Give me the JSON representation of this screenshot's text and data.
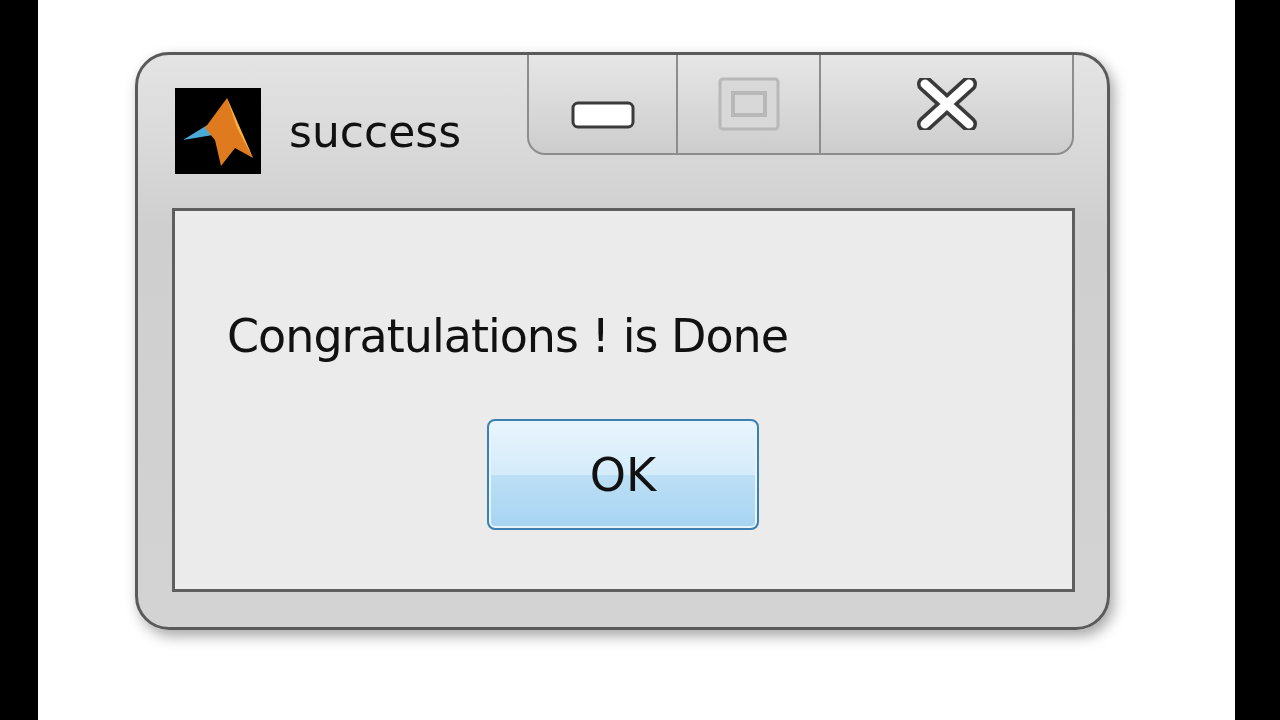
{
  "window": {
    "title": "success"
  },
  "caption_buttons": [
    {
      "kind": "minimize",
      "disabled": false
    },
    {
      "kind": "maximize",
      "disabled": true
    },
    {
      "kind": "close",
      "disabled": false
    }
  ],
  "message": "Congratulations ! is Done",
  "buttons": [
    "OK"
  ]
}
